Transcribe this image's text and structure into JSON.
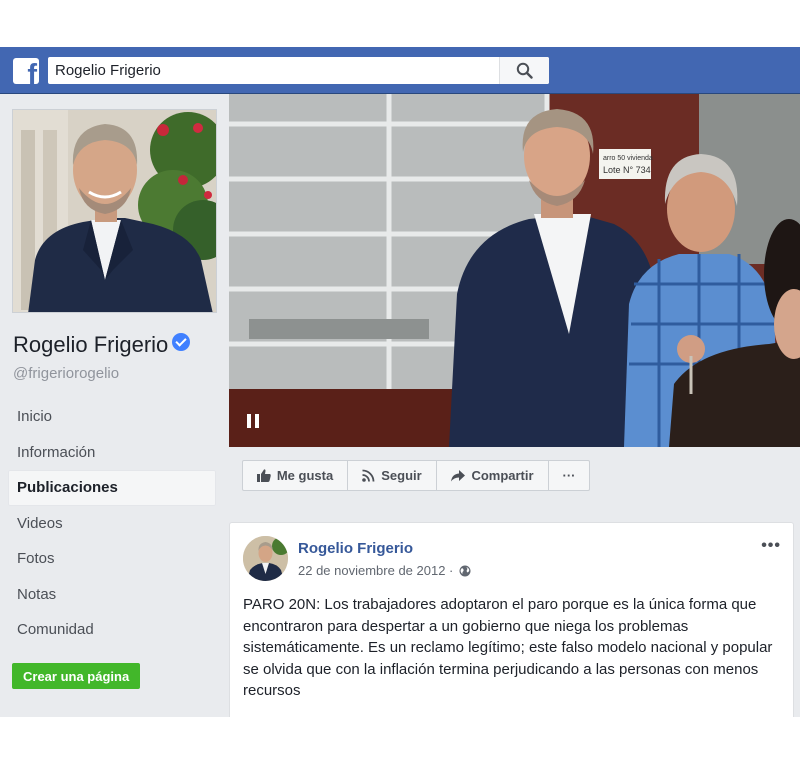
{
  "header": {
    "logo_glyph": "f",
    "search_value": "Rogelio Frigerio",
    "search_icon": "search-icon"
  },
  "profile": {
    "name": "Rogelio Frigerio",
    "handle": "@frigeriorogelio",
    "verified_icon": "verified-badge-icon"
  },
  "nav": {
    "items": [
      "Inicio",
      "Información",
      "Publicaciones",
      "Videos",
      "Fotos",
      "Notas",
      "Comunidad"
    ],
    "active": "Publicaciones"
  },
  "create_page_label": "Crear una página",
  "cover": {
    "sign_lines": [
      "arro 50 vivienda",
      "Lote N° 734"
    ],
    "control_icon": "pause-icon"
  },
  "actions": {
    "like": "Me gusta",
    "follow": "Seguir",
    "share": "Compartir",
    "more": "···"
  },
  "post": {
    "author": "Rogelio Frigerio",
    "date": "22 de noviembre de 2012 ·",
    "privacy_icon": "globe-icon",
    "menu": "•••",
    "text": "PARO 20N: Los trabajadores adoptaron el paro porque es la única forma que encontraron para despertar a un gobierno que niega los problemas sistemáticamente. Es un reclamo legítimo; este falso modelo nacional y popular se olvida que con la inflación termina perjudicando a las personas con menos recursos"
  },
  "colors": {
    "brand_blue": "#4267b2",
    "link_blue": "#365899",
    "verified_blue": "#4080ff",
    "create_green": "#42b72a",
    "page_bg": "#e9ebee"
  }
}
